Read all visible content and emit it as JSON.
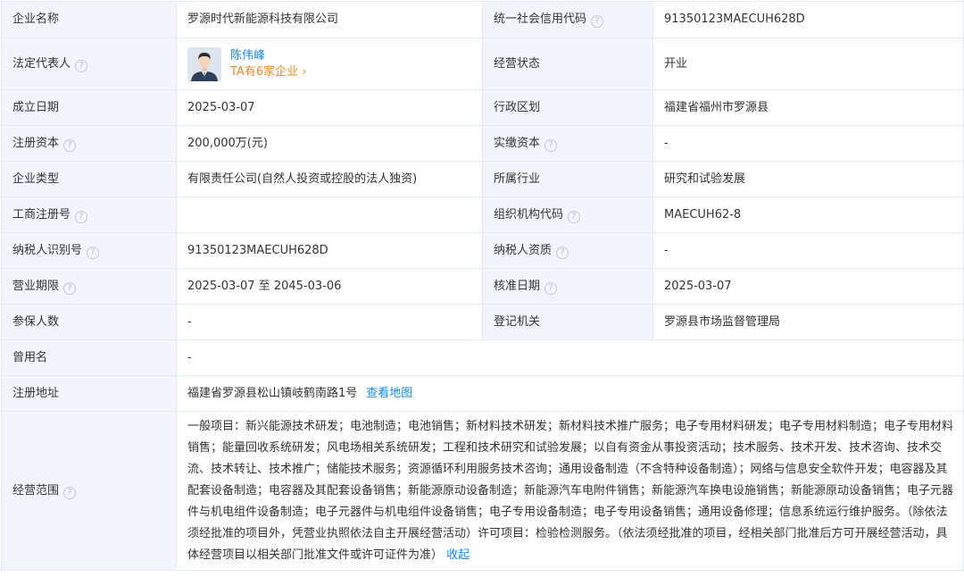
{
  "rows": {
    "company_name": {
      "label": "企业名称",
      "value": "罗源时代新能源科技有限公司"
    },
    "credit_code": {
      "label": "统一社会信用代码",
      "value": "91350123MAECUH628D"
    },
    "legal_rep": {
      "label": "法定代表人",
      "name": "陈伟峰",
      "companies": "TA有6家企业 ›"
    },
    "status": {
      "label": "经营状态",
      "value": "开业"
    },
    "established": {
      "label": "成立日期",
      "value": "2025-03-07"
    },
    "admin_region": {
      "label": "行政区划",
      "value": "福建省福州市罗源县"
    },
    "reg_capital": {
      "label": "注册资本",
      "value": "200,000万(元)"
    },
    "paid_capital": {
      "label": "实缴资本",
      "value": "-"
    },
    "company_type": {
      "label": "企业类型",
      "value": "有限责任公司(自然人投资或控股的法人独资)"
    },
    "industry": {
      "label": "所属行业",
      "value": "研究和试验发展"
    },
    "biz_reg_no": {
      "label": "工商注册号",
      "value": ""
    },
    "org_code": {
      "label": "组织机构代码",
      "value": "MAECUH62-8"
    },
    "taxpayer_id": {
      "label": "纳税人识别号",
      "value": "91350123MAECUH628D"
    },
    "taxpayer_qual": {
      "label": "纳税人资质",
      "value": "-"
    },
    "biz_term": {
      "label": "营业期限",
      "value": "2025-03-07 至 2045-03-06"
    },
    "approval_date": {
      "label": "核准日期",
      "value": "2025-03-07"
    },
    "insured": {
      "label": "参保人数",
      "value": "-"
    },
    "reg_authority": {
      "label": "登记机关",
      "value": "罗源县市场监督管理局"
    },
    "former_name": {
      "label": "曾用名",
      "value": "-"
    },
    "reg_address": {
      "label": "注册地址",
      "value": "福建省罗源县松山镇岐鹤南路1号",
      "link": "查看地图"
    },
    "biz_scope": {
      "label": "经营范围",
      "value": "一般项目：新兴能源技术研发；电池制造；电池销售；新材料技术研发；新材料技术推广服务；电子专用材料研发；电子专用材料制造；电子专用材料销售；能量回收系统研发；风电场相关系统研发；工程和技术研究和试验发展；以自有资金从事投资活动；技术服务、技术开发、技术咨询、技术交流、技术转让、技术推广；储能技术服务；资源循环利用服务技术咨询；通用设备制造（不含特种设备制造）；网络与信息安全软件开发；电容器及其配套设备制造；电容器及其配套设备销售；新能源原动设备制造；新能源汽车电附件销售；新能源汽车换电设施销售；新能源原动设备销售；电子元器件与机电组件设备制造；电子元器件与机电组件设备销售；电子专用设备制造；电子专用设备销售；通用设备修理；信息系统运行维护服务。（除依法须经批准的项目外，凭营业执照依法自主开展经营活动）许可项目：检验检测服务。（依法须经批准的项目，经相关部门批准后方可开展经营活动，具体经营项目以相关部门批准文件或许可证件为准）",
      "collapse": "收起"
    }
  },
  "help_glyph": "?",
  "colors": {
    "label_bg": "#f2f6fc",
    "border": "#e4eaf4",
    "link": "#128bed",
    "orange": "#f08a24"
  }
}
